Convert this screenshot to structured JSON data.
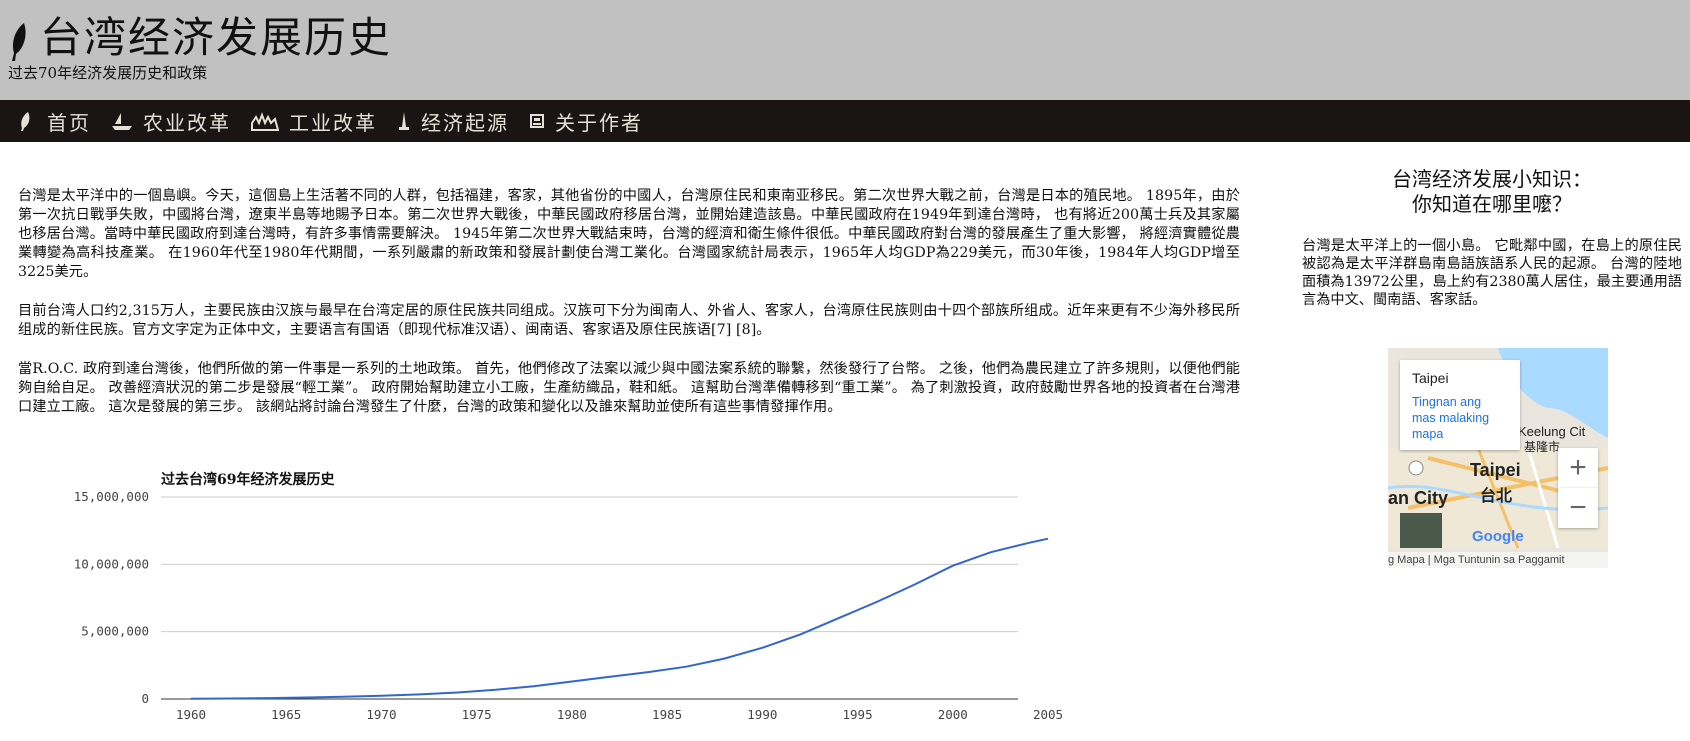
{
  "header": {
    "title": "台湾经济发展历史",
    "subtitle": "过去70年经济发展历史和政策"
  },
  "nav": [
    {
      "label": "首页",
      "icon": "feather-icon"
    },
    {
      "label": "农业改革",
      "icon": "boat-icon"
    },
    {
      "label": "工业改革",
      "icon": "factory-icon"
    },
    {
      "label": "经济起源",
      "icon": "tower-icon"
    },
    {
      "label": "关于作者",
      "icon": "author-icon"
    }
  ],
  "main": {
    "paragraphs": [
      "台灣是太平洋中的一個島嶼。今天，這個島上生活著不同的人群，包括福建，客家，其他省份的中國人，台灣原住民和東南亚移民。第二次世界大戰之前，台灣是日本的殖民地。 1895年，由於第一次抗日戰爭失敗，中國將台灣，遼東半島等地賜予日本。第二次世界大戰後，中華民國政府移居台灣，並開始建造該島。中華民國政府在1949年到達台灣時， 也有將近200萬士兵及其家屬也移居台灣。當時中華民國政府到達台灣時，有許多事情需要解決。 1945年第二次世界大戰結束時，台灣的經濟和衛生條件很低。中華民國政府對台灣的發展產生了重大影響， 將經濟實體從農業轉變為高科技產業。 在1960年代至1980年代期間，一系列嚴肅的新政策和發展計劃使台灣工業化。台灣國家統計局表示，1965年人均GDP為229美元，而30年後，1984年人均GDP增至3225美元。",
      "目前台湾人口约2,315万人，主要民族由汉族与最早在台湾定居的原住民族共同组成。汉族可下分为闽南人、外省人、客家人，台湾原住民族则由十四个部族所组成。近年来更有不少海外移民所组成的新住民族。官方文字定为正体中文，主要语言有国语（即现代标准汉语）、闽南语、客家语及原住民族语[7] [8]。",
      "當R.O.C. 政府到達台灣後，他們所做的第一件事是一系列的土地政策。 首先，他們修改了法案以減少與中國法案系統的聯繫，然後發行了台幣。 之後，他們為農民建立了許多規則，以便他們能夠自給自足。 改善經濟狀況的第二步是發展“輕工業”。 政府開始幫助建立小工廠，生產紡織品，鞋和紙。 這幫助台灣準備轉移到“重工業”。 為了刺激投資，政府鼓勵世界各地的投資者在台灣港口建立工廠。 這次是發展的第三步。 該網站將討論台灣發生了什麼，台灣的政策和變化以及誰來幫助並使所有這些事情發揮作用。"
    ]
  },
  "sidebar": {
    "title_line1": "台湾经济发展小知识：",
    "title_line2": "你知道在哪里嚒？",
    "text": "台灣是太平洋上的一個小島。 它毗鄰中國，在島上的原住民被認為是太平洋群島南島語族語系人民的起源。 台灣的陸地面積為13972公里，島上約有2380萬人居住，最主要通用語言為中文、閩南語、客家話。",
    "map": {
      "city": "Taipei",
      "link": "Tingnan ang mas malaking mapa",
      "label_taipei": "Taipei",
      "label_taipei_cn": "台北",
      "label_keelung": "Keelung Cit",
      "label_keelung_cn": "基隆市",
      "label_newtaipei": "an City",
      "label_google": "Google",
      "footer": "g Mapa | Mga Tuntunin sa Paggamit",
      "zoom_in": "+",
      "zoom_out": "−"
    }
  },
  "chart_data": {
    "type": "line",
    "title": "过去台湾69年经济发展历史",
    "x": [
      1960,
      1962,
      1964,
      1966,
      1968,
      1970,
      1972,
      1974,
      1976,
      1978,
      1980,
      1982,
      1984,
      1986,
      1988,
      1990,
      1992,
      1994,
      1996,
      1998,
      2000,
      2002,
      2004,
      2005
    ],
    "y": [
      20000,
      40000,
      70000,
      110000,
      160000,
      240000,
      340000,
      480000,
      680000,
      950000,
      1300000,
      1650000,
      2000000,
      2400000,
      3000000,
      3800000,
      4800000,
      6000000,
      7200000,
      8500000,
      9900000,
      10900000,
      11600000,
      11900000
    ],
    "xticks": [
      "1960",
      "1965",
      "1970",
      "1975",
      "1980",
      "1985",
      "1990",
      "1995",
      "2000",
      "2005"
    ],
    "yticks": [
      "0",
      "5,000,000",
      "10,000,000",
      "15,000,000"
    ],
    "ylim": [
      0,
      15000000
    ],
    "xlim": [
      1960,
      2005
    ],
    "color": "#3366cc",
    "grid": true
  }
}
